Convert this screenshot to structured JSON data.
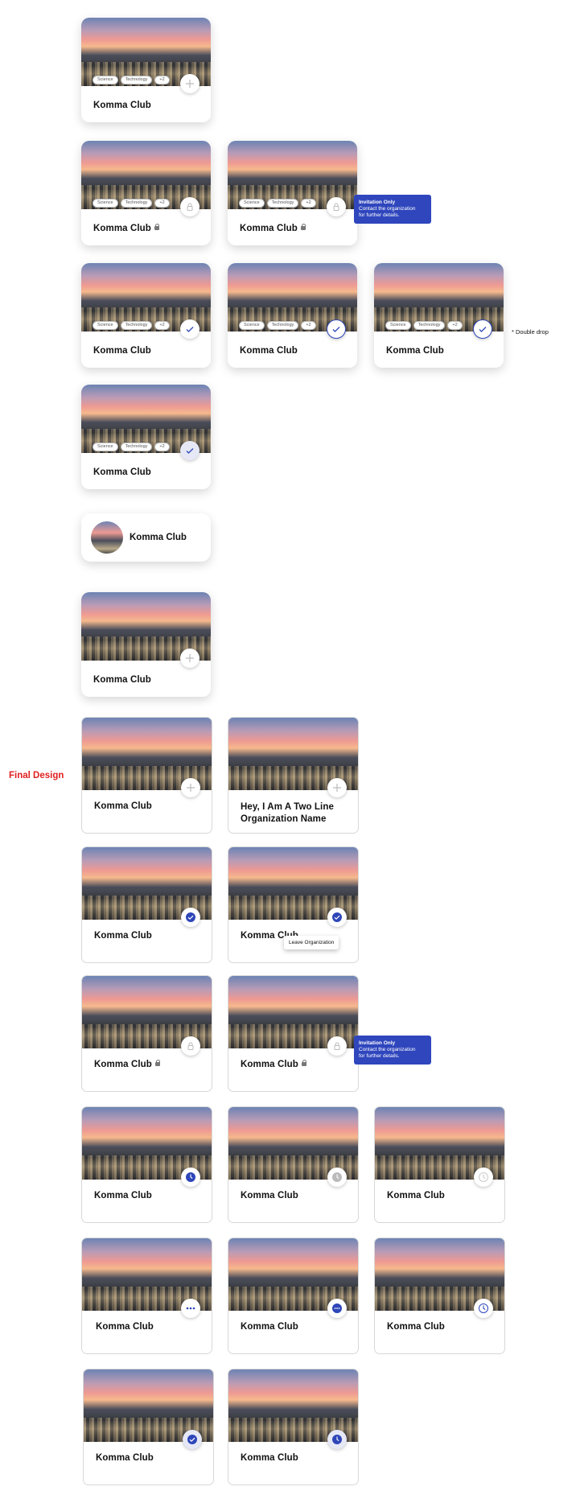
{
  "club_name": "Komma Club",
  "two_line_name_1": "Hey, I Am A Two Line",
  "two_line_name_2": "Organization Name",
  "tags": [
    "Science",
    "Technology",
    "+2"
  ],
  "tooltip": {
    "title": "Invitation Only",
    "line1": "Contact the organization",
    "line2": "for further details."
  },
  "double_drop_note": "* Double drop",
  "final_design_label": "Final Design",
  "leave_menu_label": "Leave Organization",
  "colors": {
    "accent": "#2e46b8",
    "final_label": "#e02020"
  },
  "icons": [
    "plus-icon",
    "lock-icon",
    "check-icon",
    "clock-icon",
    "more-icon"
  ]
}
